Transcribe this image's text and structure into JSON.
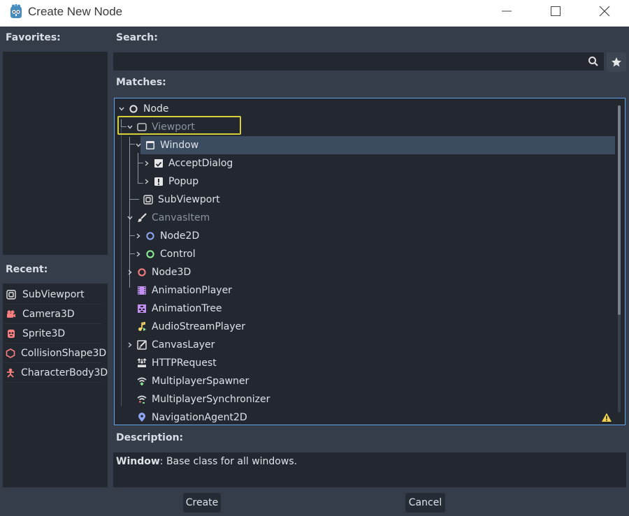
{
  "window": {
    "title": "Create New Node",
    "controls": {
      "minimize": "minimize-icon",
      "maximize": "maximize-icon",
      "close": "close-icon"
    }
  },
  "favorites": {
    "label": "Favorites:"
  },
  "recent": {
    "label": "Recent:",
    "items": [
      {
        "label": "SubViewport",
        "icon": "subviewport-icon"
      },
      {
        "label": "Camera3D",
        "icon": "camera3d-icon"
      },
      {
        "label": "Sprite3D",
        "icon": "sprite3d-icon"
      },
      {
        "label": "CollisionShape3D",
        "icon": "collisionshape3d-icon"
      },
      {
        "label": "CharacterBody3D",
        "icon": "characterbody3d-icon"
      }
    ]
  },
  "search": {
    "label": "Search:",
    "value": "",
    "placeholder": ""
  },
  "matches": {
    "label": "Matches:",
    "rows": [
      {
        "label": "Node",
        "depth": 0,
        "arrow": "down",
        "icon": "node-icon",
        "dim": false
      },
      {
        "label": "Viewport",
        "depth": 1,
        "arrow": "down",
        "icon": "viewport-icon",
        "dim": true
      },
      {
        "label": "Window",
        "depth": 2,
        "arrow": "down",
        "icon": "window-icon",
        "dim": false,
        "selected": true
      },
      {
        "label": "AcceptDialog",
        "depth": 3,
        "arrow": "right",
        "icon": "acceptdialog-icon",
        "dim": false
      },
      {
        "label": "Popup",
        "depth": 3,
        "arrow": "right",
        "icon": "popup-icon",
        "dim": false
      },
      {
        "label": "SubViewport",
        "depth": 2,
        "arrow": "none",
        "icon": "subviewport-icon",
        "dim": false
      },
      {
        "label": "CanvasItem",
        "depth": 1,
        "arrow": "down",
        "icon": "canvasitem-icon",
        "dim": true
      },
      {
        "label": "Node2D",
        "depth": 2,
        "arrow": "right",
        "icon": "node2d-icon",
        "dim": false
      },
      {
        "label": "Control",
        "depth": 2,
        "arrow": "right",
        "icon": "control-icon",
        "dim": false
      },
      {
        "label": "Node3D",
        "depth": 1,
        "arrow": "right",
        "icon": "node3d-icon",
        "dim": false
      },
      {
        "label": "AnimationPlayer",
        "depth": 1,
        "arrow": "none",
        "icon": "animationplayer-icon",
        "dim": false
      },
      {
        "label": "AnimationTree",
        "depth": 1,
        "arrow": "none",
        "icon": "animationtree-icon",
        "dim": false
      },
      {
        "label": "AudioStreamPlayer",
        "depth": 1,
        "arrow": "none",
        "icon": "audiostreamplayer-icon",
        "dim": false
      },
      {
        "label": "CanvasLayer",
        "depth": 1,
        "arrow": "right",
        "icon": "canvaslayer-icon",
        "dim": false
      },
      {
        "label": "HTTPRequest",
        "depth": 1,
        "arrow": "none",
        "icon": "httprequest-icon",
        "dim": false
      },
      {
        "label": "MultiplayerSpawner",
        "depth": 1,
        "arrow": "none",
        "icon": "multiplayerspawner-icon",
        "dim": false
      },
      {
        "label": "MultiplayerSynchronizer",
        "depth": 1,
        "arrow": "none",
        "icon": "multiplayersynchronizer-icon",
        "dim": false
      },
      {
        "label": "NavigationAgent2D",
        "depth": 1,
        "arrow": "none",
        "icon": "navigationagent2d-icon",
        "dim": false
      }
    ]
  },
  "description": {
    "label": "Description:",
    "class_name": "Window",
    "text": ": Base class for all windows."
  },
  "buttons": {
    "create": "Create",
    "cancel": "Cancel"
  },
  "colors": {
    "accent": "#5fa7e8",
    "selection": "#3b4b60",
    "hover_outline": "#d6cf3a",
    "warning": "#f5d24c"
  }
}
